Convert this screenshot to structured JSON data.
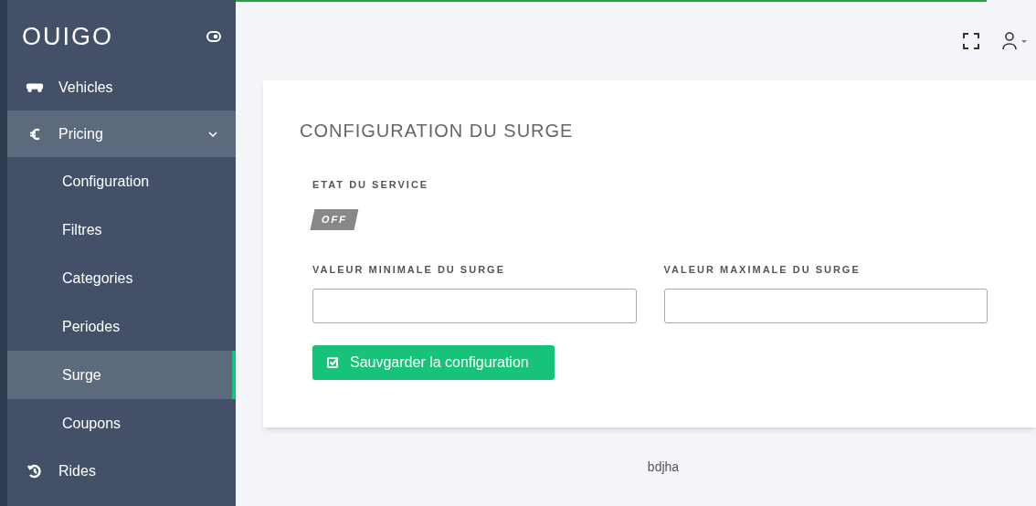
{
  "sidebar": {
    "brand": "OUIGO",
    "items": [
      {
        "kind": "vehicle",
        "label": "Vehicles",
        "expanded": false
      },
      {
        "kind": "euro",
        "label": "Pricing",
        "expanded": true,
        "children": [
          {
            "label": "Configuration",
            "selected": false
          },
          {
            "label": "Filtres",
            "selected": false
          },
          {
            "label": "Categories",
            "selected": false
          },
          {
            "label": "Periodes",
            "selected": false
          },
          {
            "label": "Surge",
            "selected": true
          },
          {
            "label": "Coupons",
            "selected": false
          }
        ]
      },
      {
        "kind": "history",
        "label": "Rides",
        "expanded": false
      }
    ]
  },
  "card": {
    "title": "CONFIGURATION DU SURGE",
    "service_label": "ETAT DU SERVICE",
    "service_on": false,
    "service_text": "OFF",
    "fields": [
      {
        "label": "VALEUR MINIMALE DU SURGE"
      },
      {
        "label": "VALEUR MAXIMALE DU SURGE"
      }
    ],
    "save_button": "Sauvgarder la configuration"
  },
  "footer": "bdjha"
}
